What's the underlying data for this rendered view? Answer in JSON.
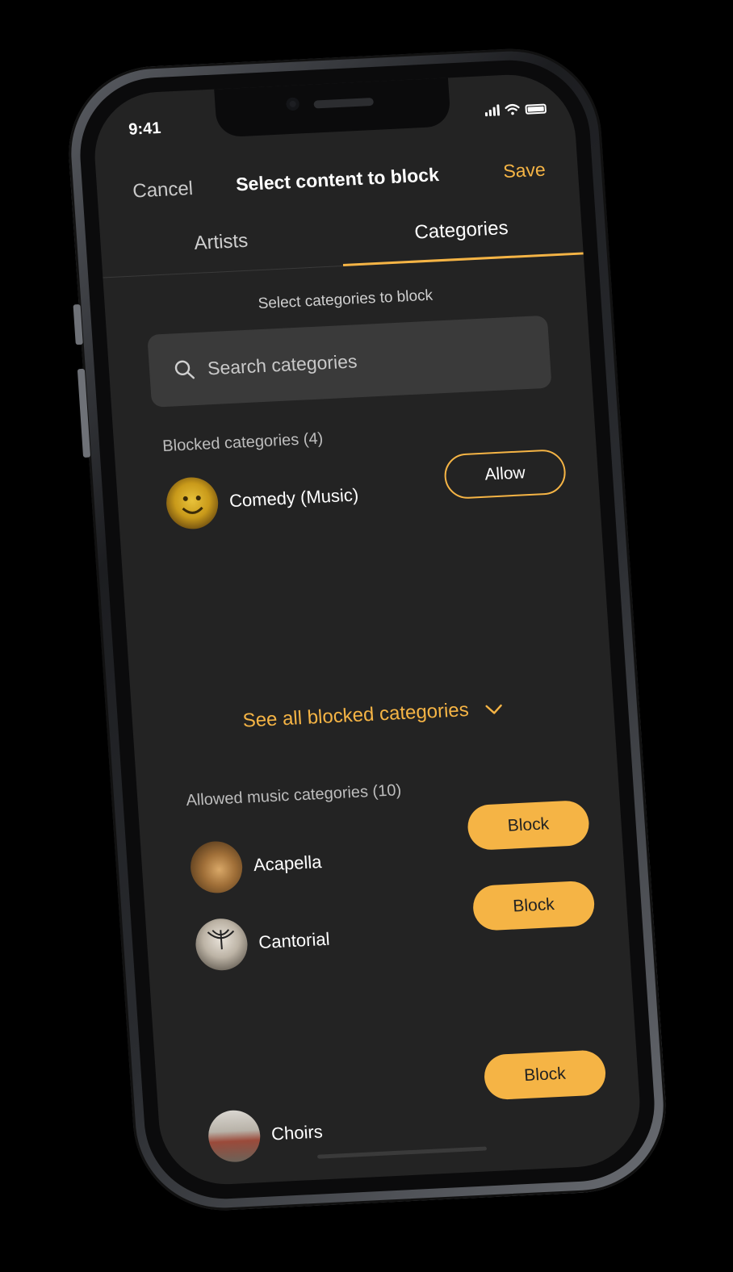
{
  "status": {
    "time": "9:41"
  },
  "nav": {
    "cancel": "Cancel",
    "title": "Select content to block",
    "save": "Save"
  },
  "tabs": [
    {
      "label": "Artists",
      "active": false
    },
    {
      "label": "Categories",
      "active": true
    }
  ],
  "hint": "Select categories to block",
  "search": {
    "placeholder": "Search categories"
  },
  "blocked": {
    "label": "Blocked categories (4)",
    "items": [
      {
        "name": "Comedy (Music)",
        "action": "Allow"
      }
    ]
  },
  "see_all": "See all blocked categories",
  "allowed": {
    "label": "Allowed music categories (10)",
    "items": [
      {
        "name": "Acapella",
        "action": "Block"
      },
      {
        "name": "Cantorial",
        "action": "Block"
      },
      {
        "name": "Choirs",
        "action": "Block"
      }
    ]
  },
  "colors": {
    "accent": "#f5b445",
    "background": "#232323",
    "surface": "#3a3a3a"
  },
  "icons": [
    "search-icon",
    "chevron-down-icon",
    "signal-icon",
    "wifi-icon",
    "battery-icon"
  ]
}
